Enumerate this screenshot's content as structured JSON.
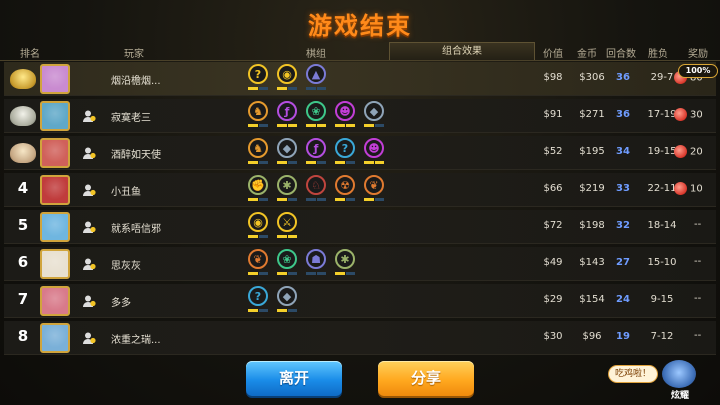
{
  "title": "游戏结束",
  "headers": {
    "rank": "排名",
    "player": "玩家",
    "lineup": "棋组",
    "combo": "组合效果",
    "value": "价值",
    "gold": "金币",
    "rounds": "回合数",
    "record": "胜负",
    "reward": "奖励"
  },
  "colors": {
    "accent": "#ff8a1a",
    "trait_on": "#f4cf2a",
    "trait_off": "#2c4a66",
    "round_text": "#6f9cff"
  },
  "players": [
    {
      "rank": "1",
      "rank_style": "gold",
      "avatar_color": "#c98bd0",
      "name": "烟沿檐烟...",
      "traits": [
        {
          "icon": "question",
          "glyph": "?",
          "color": "#f2c425",
          "pips": [
            1,
            0
          ]
        },
        {
          "icon": "mask",
          "glyph": "◉",
          "color": "#f2c425",
          "pips": [
            1,
            0
          ]
        },
        {
          "icon": "wizard-hat",
          "glyph": "▲",
          "color": "#7b7bd6",
          "pips": [
            0,
            0
          ]
        }
      ],
      "value": "$98",
      "gold": "$306",
      "rounds": "36",
      "record": "29-7",
      "reward": "80"
    },
    {
      "rank": "2",
      "rank_style": "silver",
      "avatar_color": "#5fa8c8",
      "name": "寂寞老三",
      "traits": [
        {
          "icon": "horn",
          "glyph": "♞",
          "color": "#e59a2e",
          "pips": [
            1,
            0
          ]
        },
        {
          "icon": "claw",
          "glyph": "ƒ",
          "color": "#b44ee0",
          "pips": [
            1,
            1
          ]
        },
        {
          "icon": "paw",
          "glyph": "❀",
          "color": "#3ec78a",
          "pips": [
            1,
            1
          ]
        },
        {
          "icon": "demon",
          "glyph": "☻",
          "color": "#c23ed6",
          "pips": [
            1,
            1
          ]
        },
        {
          "icon": "knight",
          "glyph": "◆",
          "color": "#8fa4b8",
          "pips": [
            1,
            0
          ]
        }
      ],
      "value": "$91",
      "gold": "$271",
      "rounds": "36",
      "record": "17-19",
      "reward": "30"
    },
    {
      "rank": "3",
      "rank_style": "bronze",
      "avatar_color": "#d0605a",
      "name": "酒醉如天使",
      "traits": [
        {
          "icon": "horn",
          "glyph": "♞",
          "color": "#e59a2e",
          "pips": [
            1,
            0
          ]
        },
        {
          "icon": "knight",
          "glyph": "◆",
          "color": "#8fa4b8",
          "pips": [
            1,
            0
          ]
        },
        {
          "icon": "claw",
          "glyph": "ƒ",
          "color": "#b44ee0",
          "pips": [
            1,
            0
          ]
        },
        {
          "icon": "question",
          "glyph": "?",
          "color": "#3aa8d8",
          "pips": [
            1,
            0
          ]
        },
        {
          "icon": "demon",
          "glyph": "☻",
          "color": "#c23ed6",
          "pips": [
            1,
            1
          ]
        }
      ],
      "value": "$52",
      "gold": "$195",
      "rounds": "34",
      "record": "19-15",
      "reward": "20"
    },
    {
      "rank": "4",
      "rank_style": "number",
      "avatar_color": "#c03c3c",
      "name": "小丑鱼",
      "traits": [
        {
          "icon": "fist",
          "glyph": "✊",
          "color": "#9bb36a",
          "pips": [
            1,
            0
          ]
        },
        {
          "icon": "spider",
          "glyph": "✱",
          "color": "#9bb36a",
          "pips": [
            1,
            0
          ]
        },
        {
          "icon": "horse",
          "glyph": "♘",
          "color": "#c0453e",
          "pips": [
            0,
            0
          ]
        },
        {
          "icon": "beast",
          "glyph": "☢",
          "color": "#e07a30",
          "pips": [
            1,
            0
          ]
        },
        {
          "icon": "leaf",
          "glyph": "❦",
          "color": "#e07a30",
          "pips": [
            1,
            0
          ]
        }
      ],
      "value": "$66",
      "gold": "$219",
      "rounds": "33",
      "record": "22-11",
      "reward": "10"
    },
    {
      "rank": "5",
      "rank_style": "number",
      "avatar_color": "#6fb6e0",
      "name": "就系唔信邪",
      "traits": [
        {
          "icon": "mask",
          "glyph": "◉",
          "color": "#f2c425",
          "pips": [
            1,
            0
          ]
        },
        {
          "icon": "blades",
          "glyph": "⚔",
          "color": "#f2c425",
          "pips": [
            1,
            1
          ]
        }
      ],
      "value": "$72",
      "gold": "$198",
      "rounds": "32",
      "record": "18-14",
      "reward": "--"
    },
    {
      "rank": "6",
      "rank_style": "number",
      "avatar_color": "#e8e0d0",
      "name": "思灰灰",
      "traits": [
        {
          "icon": "leaf",
          "glyph": "❦",
          "color": "#e07a30",
          "pips": [
            1,
            0
          ]
        },
        {
          "icon": "paw",
          "glyph": "❀",
          "color": "#3ec78a",
          "pips": [
            1,
            0
          ]
        },
        {
          "icon": "wizard",
          "glyph": "☗",
          "color": "#7b7bd6",
          "pips": [
            0,
            0
          ]
        },
        {
          "icon": "spider",
          "glyph": "✱",
          "color": "#9bb36a",
          "pips": [
            1,
            0
          ]
        }
      ],
      "value": "$49",
      "gold": "$143",
      "rounds": "27",
      "record": "15-10",
      "reward": "--"
    },
    {
      "rank": "7",
      "rank_style": "number",
      "avatar_color": "#d87a8a",
      "name": "多多",
      "traits": [
        {
          "icon": "question",
          "glyph": "?",
          "color": "#3aa8d8",
          "pips": [
            1,
            0
          ]
        },
        {
          "icon": "knight",
          "glyph": "◆",
          "color": "#8fa4b8",
          "pips": [
            1,
            0
          ]
        }
      ],
      "value": "$29",
      "gold": "$154",
      "rounds": "24",
      "record": "9-15",
      "reward": "--"
    },
    {
      "rank": "8",
      "rank_style": "number",
      "avatar_color": "#7ab0d8",
      "name": "浓重之瑞...",
      "traits": [],
      "value": "$30",
      "gold": "$96",
      "rounds": "19",
      "record": "7-12",
      "reward": "--"
    }
  ],
  "reward_percent": "100%",
  "buttons": {
    "leave": "离开",
    "share": "分享"
  },
  "bubble": "吃鸡啦！",
  "mascot_label": "炫耀"
}
